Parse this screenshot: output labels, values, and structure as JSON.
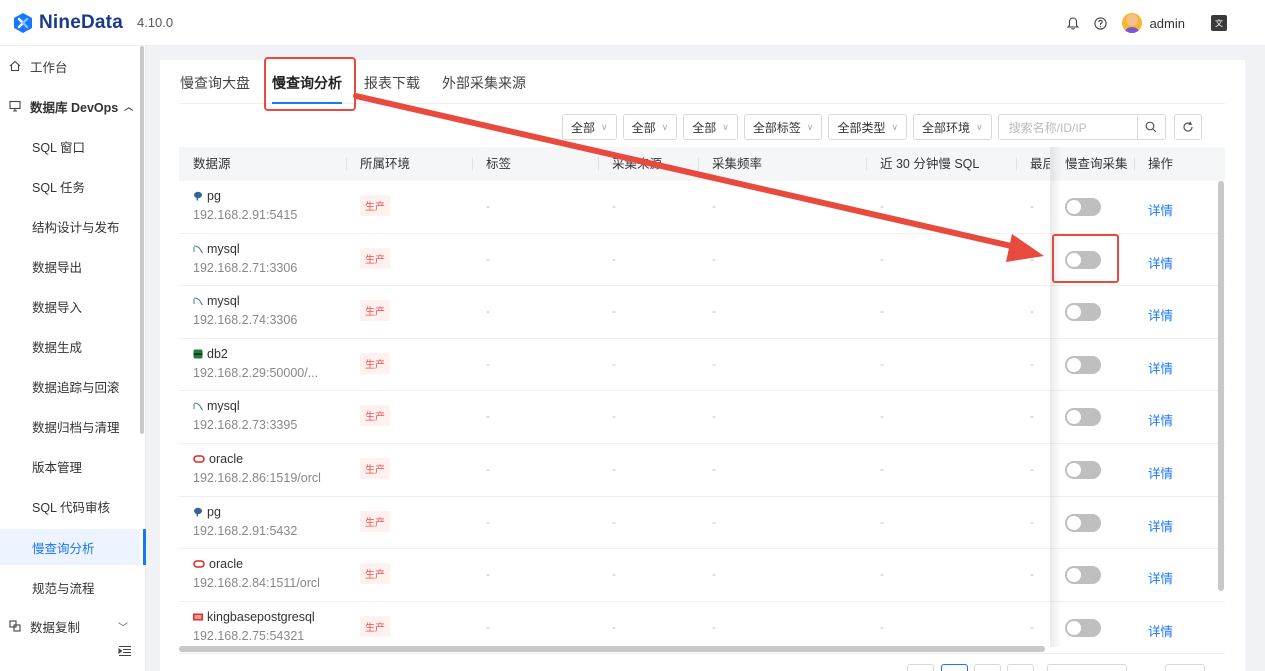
{
  "header": {
    "brand": "NineData",
    "version": "4.10.0",
    "user": "admin",
    "lang_icon": "translate-icon"
  },
  "sidebar": {
    "items": [
      {
        "label": "工作台",
        "icon": "home-icon"
      },
      {
        "label": "数据库 DevOps",
        "icon": "monitor-icon"
      },
      {
        "label": "SQL 窗口"
      },
      {
        "label": "SQL 任务"
      },
      {
        "label": "结构设计与发布"
      },
      {
        "label": "数据导出"
      },
      {
        "label": "数据导入"
      },
      {
        "label": "数据生成"
      },
      {
        "label": "数据追踪与回滚"
      },
      {
        "label": "数据归档与清理"
      },
      {
        "label": "版本管理"
      },
      {
        "label": "SQL 代码审核"
      },
      {
        "label": "慢查询分析"
      },
      {
        "label": "规范与流程"
      },
      {
        "label": "数据复制",
        "icon": "copy-icon"
      }
    ]
  },
  "tabs": [
    {
      "label": "慢查询大盘"
    },
    {
      "label": "慢查询分析"
    },
    {
      "label": "报表下载"
    },
    {
      "label": "外部采集来源"
    }
  ],
  "filters": {
    "f1": "全部",
    "f2": "全部",
    "f3": "全部",
    "f4": "全部标签",
    "f5": "全部类型",
    "f6": "全部环境",
    "search_placeholder": "搜索名称/ID/IP"
  },
  "table": {
    "columns": [
      "数据源",
      "所属环境",
      "标签",
      "采集来源",
      "采集频率",
      "近 30 分钟慢 SQL",
      "最后",
      "慢查询采集",
      "操作"
    ],
    "rows": [
      {
        "type": "pg",
        "name": "pg",
        "addr": "192.168.2.91:5415",
        "env": "生产",
        "tag": "-",
        "source": "-",
        "freq": "-",
        "slow": "-",
        "last": "-",
        "action": "详情"
      },
      {
        "type": "mysql",
        "name": "mysql",
        "addr": "192.168.2.71:3306",
        "env": "生产",
        "tag": "-",
        "source": "-",
        "freq": "-",
        "slow": "-",
        "last": "-",
        "action": "详情"
      },
      {
        "type": "mysql",
        "name": "mysql",
        "addr": "192.168.2.74:3306",
        "env": "生产",
        "tag": "-",
        "source": "-",
        "freq": "-",
        "slow": "-",
        "last": "-",
        "action": "详情"
      },
      {
        "type": "db2",
        "name": "db2",
        "addr": "192.168.2.29:50000/...",
        "env": "生产",
        "tag": "-",
        "source": "-",
        "freq": "-",
        "slow": "-",
        "last": "-",
        "action": "详情"
      },
      {
        "type": "mysql",
        "name": "mysql",
        "addr": "192.168.2.73:3395",
        "env": "生产",
        "tag": "-",
        "source": "-",
        "freq": "-",
        "slow": "-",
        "last": "-",
        "action": "详情"
      },
      {
        "type": "oracle",
        "name": "oracle",
        "addr": "192.168.2.86:1519/orcl",
        "env": "生产",
        "tag": "-",
        "source": "-",
        "freq": "-",
        "slow": "-",
        "last": "-",
        "action": "详情"
      },
      {
        "type": "pg",
        "name": "pg",
        "addr": "192.168.2.91:5432",
        "env": "生产",
        "tag": "-",
        "source": "-",
        "freq": "-",
        "slow": "-",
        "last": "-",
        "action": "详情"
      },
      {
        "type": "oracle",
        "name": "oracle",
        "addr": "192.168.2.84:1511/orcl",
        "env": "生产",
        "tag": "-",
        "source": "-",
        "freq": "-",
        "slow": "-",
        "last": "-",
        "action": "详情"
      },
      {
        "type": "kingbase",
        "name": "kingbasepostgresql",
        "addr": "192.168.2.75:54321",
        "env": "生产",
        "tag": "-",
        "source": "-",
        "freq": "-",
        "slow": "-",
        "last": "-",
        "action": "详情"
      }
    ]
  },
  "colors": {
    "accent": "#1677ff",
    "highlight": "#e84a3d",
    "env_tag": "#f5514a"
  }
}
